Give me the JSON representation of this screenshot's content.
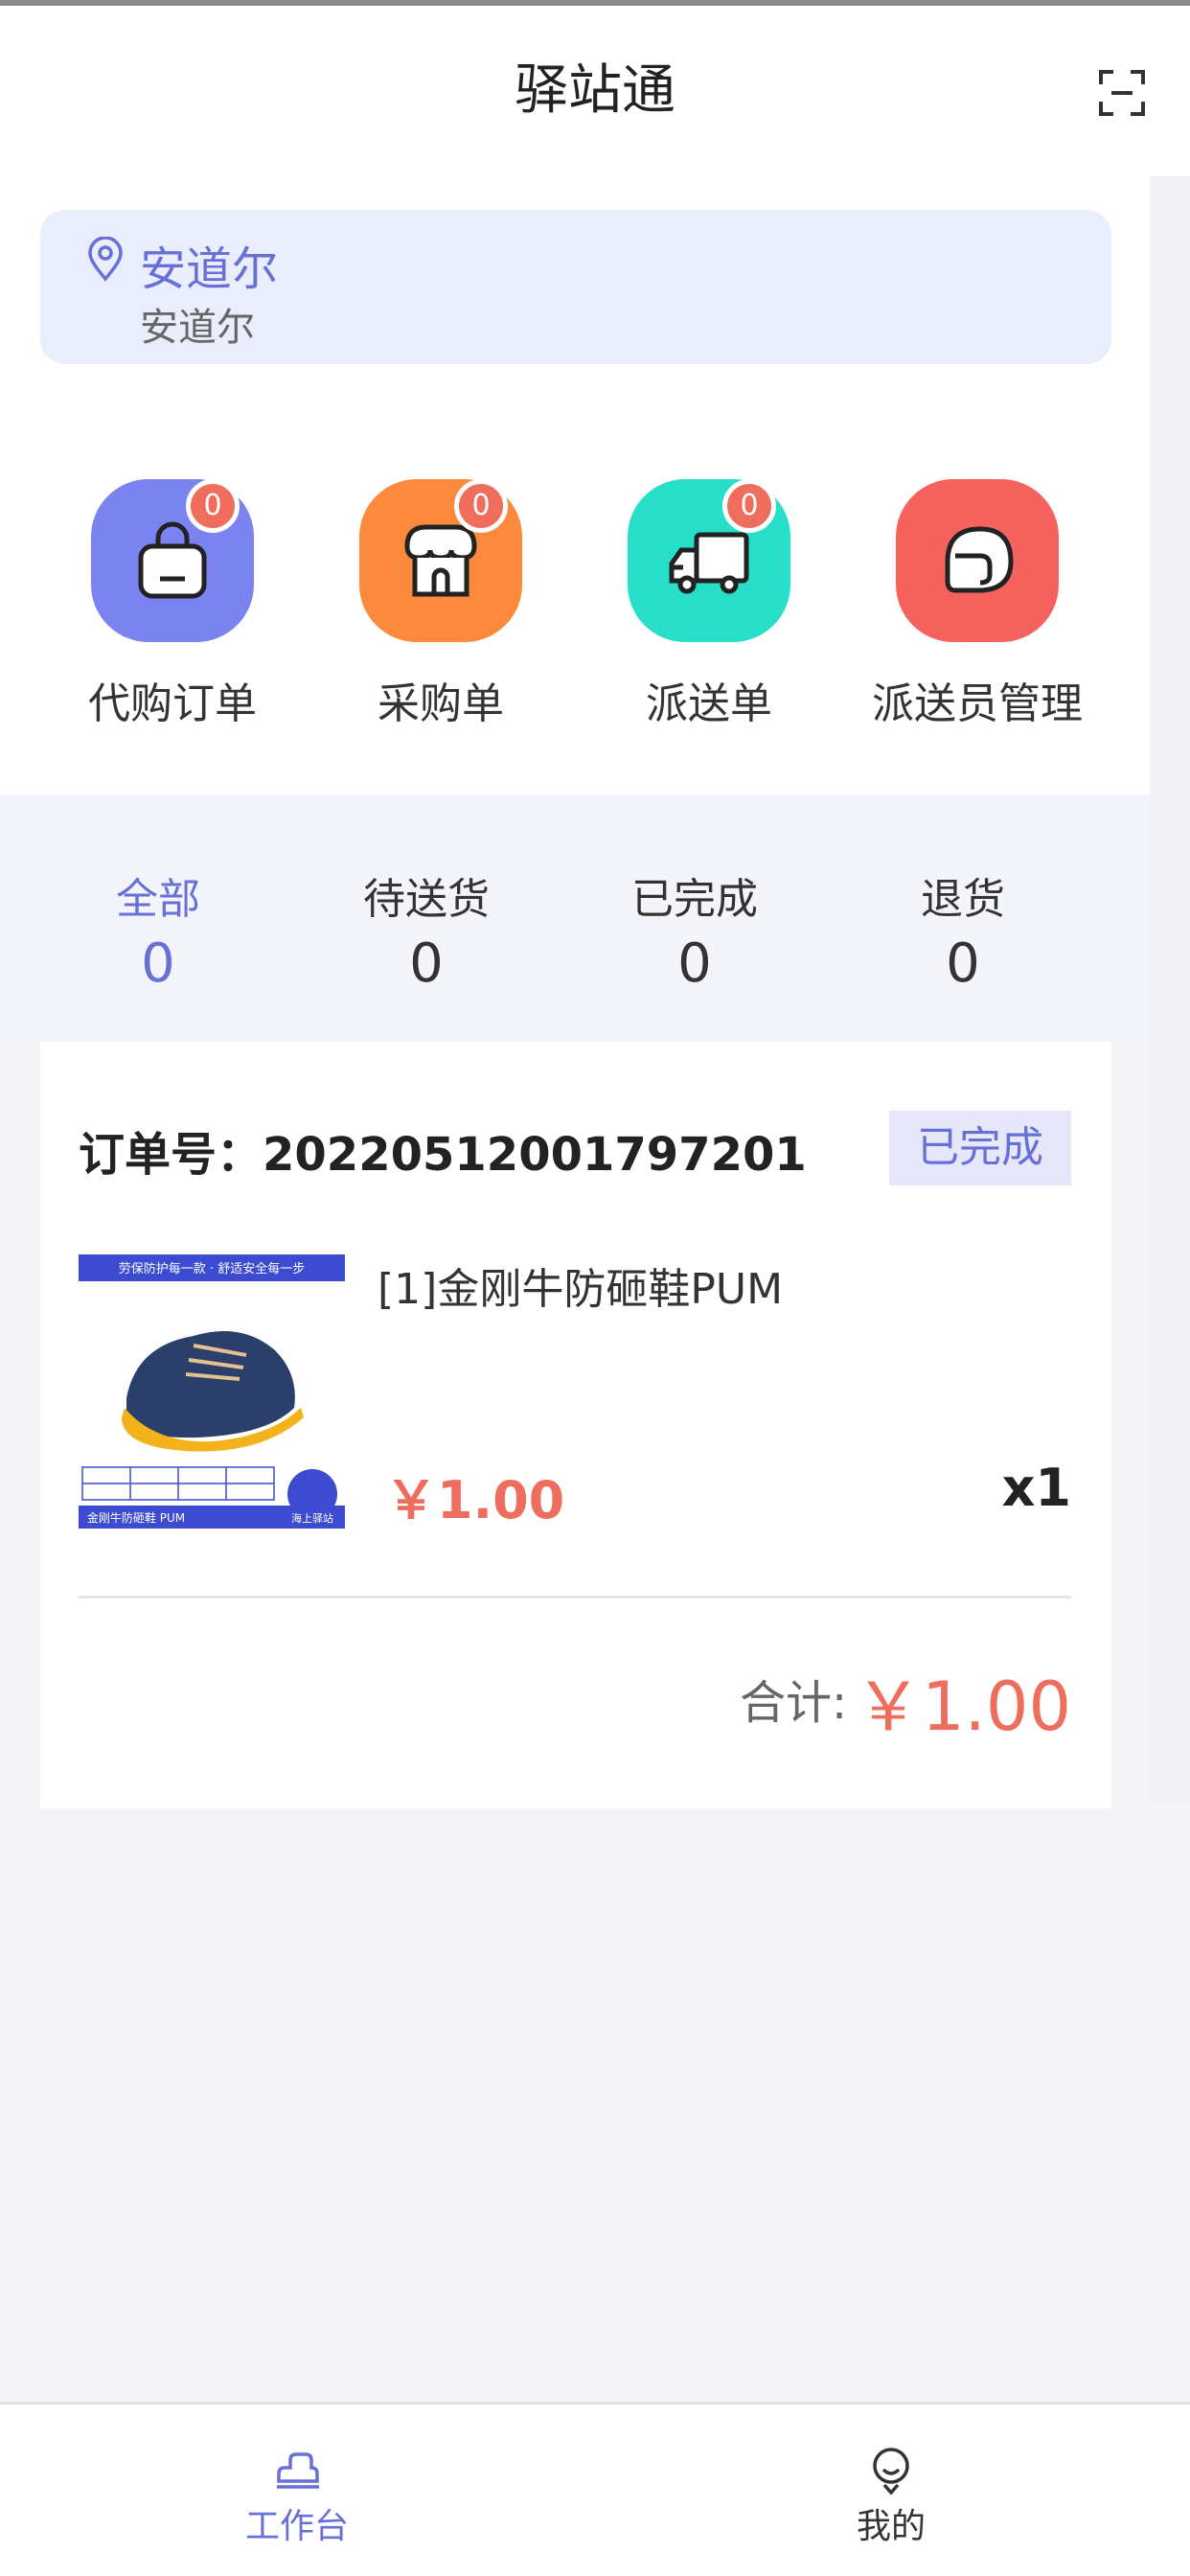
{
  "header": {
    "title": "驿站通"
  },
  "location": {
    "name": "安道尔",
    "sub": "安道尔"
  },
  "menu": [
    {
      "label": "代购订单",
      "badge": "0",
      "color": "#7b83f0"
    },
    {
      "label": "采购单",
      "badge": "0",
      "color": "#fd8a3c"
    },
    {
      "label": "派送单",
      "badge": "0",
      "color": "#27dfc8"
    },
    {
      "label": "派送员管理",
      "color": "#f6625e"
    }
  ],
  "tabs": [
    {
      "label": "全部",
      "count": "0",
      "active": true
    },
    {
      "label": "待送货",
      "count": "0"
    },
    {
      "label": "已完成",
      "count": "0"
    },
    {
      "label": "退货",
      "count": "0"
    }
  ],
  "order": {
    "order_no": "订单号：20220512001797201",
    "status": "已完成",
    "product_name": "[1]金刚牛防砸鞋PUM",
    "price": "￥1.00",
    "qty": "x1",
    "total_label": "合计:",
    "total_value": "￥1.00",
    "image_banner": "劳保防护每一款 · 舒适安全每一步",
    "image_footer": "金刚牛防砸鞋 PUM",
    "image_brand": "海上驿站"
  },
  "tabbar": [
    {
      "label": "工作台",
      "active": true
    },
    {
      "label": "我的"
    }
  ],
  "colors": {
    "accent": "#6670d6",
    "price": "#ef6d5c"
  }
}
